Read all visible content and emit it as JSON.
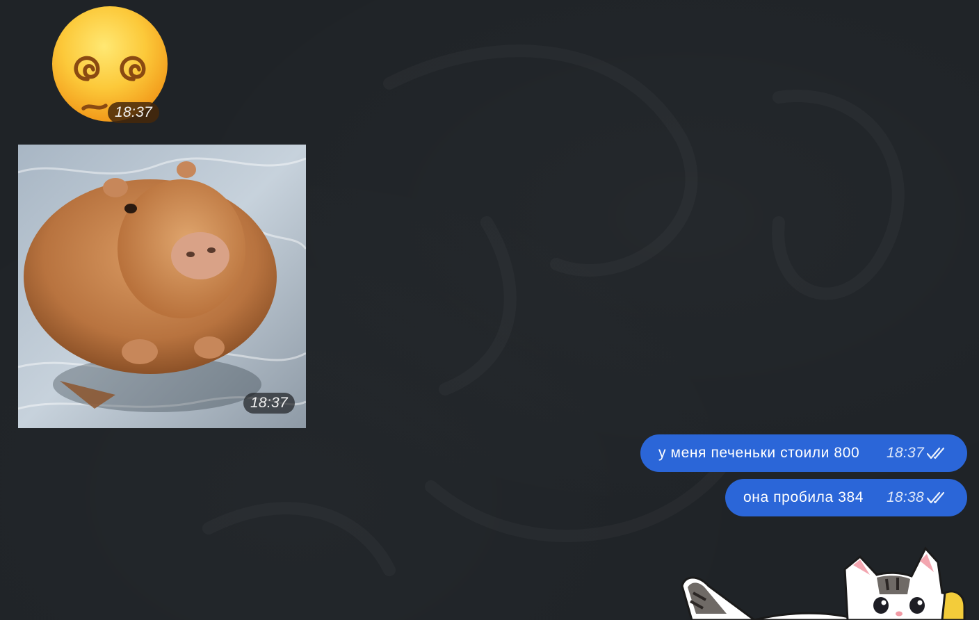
{
  "chat": {
    "background_color": "#1f2327"
  },
  "messages": {
    "emoji_sticker": {
      "emoji": "face-with-spiral-eyes",
      "time": "18:37"
    },
    "photo": {
      "subject": "capybara",
      "time": "18:37"
    },
    "outgoing": [
      {
        "text": "у меня печеньки стоили 800",
        "time": "18:37",
        "status": "read-double-check"
      },
      {
        "text": "она пробила 384",
        "time": "18:38",
        "status": "read-double-check"
      }
    ],
    "cat_sticker": {
      "subject": "cat"
    }
  },
  "colors": {
    "outgoing_bubble": "#2b66d8",
    "time_pill": "#1b1d20"
  }
}
